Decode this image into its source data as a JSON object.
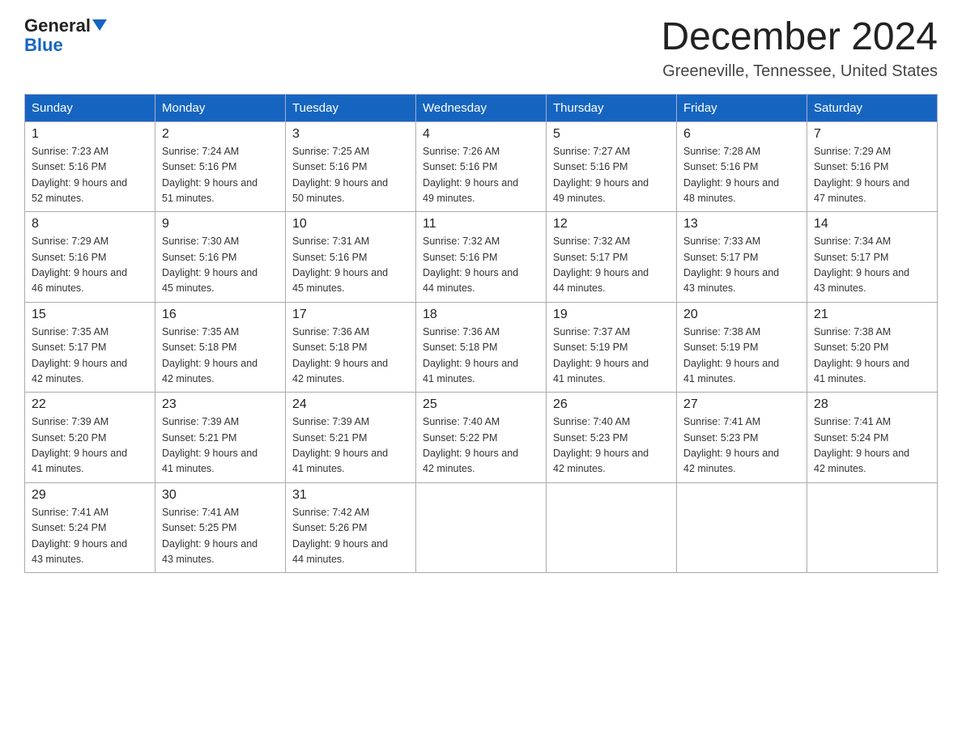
{
  "header": {
    "logo_line1": "General",
    "logo_line2": "Blue",
    "main_title": "December 2024",
    "subtitle": "Greeneville, Tennessee, United States"
  },
  "days_of_week": [
    "Sunday",
    "Monday",
    "Tuesday",
    "Wednesday",
    "Thursday",
    "Friday",
    "Saturday"
  ],
  "weeks": [
    [
      {
        "day": "1",
        "sunrise": "7:23 AM",
        "sunset": "5:16 PM",
        "daylight": "9 hours and 52 minutes."
      },
      {
        "day": "2",
        "sunrise": "7:24 AM",
        "sunset": "5:16 PM",
        "daylight": "9 hours and 51 minutes."
      },
      {
        "day": "3",
        "sunrise": "7:25 AM",
        "sunset": "5:16 PM",
        "daylight": "9 hours and 50 minutes."
      },
      {
        "day": "4",
        "sunrise": "7:26 AM",
        "sunset": "5:16 PM",
        "daylight": "9 hours and 49 minutes."
      },
      {
        "day": "5",
        "sunrise": "7:27 AM",
        "sunset": "5:16 PM",
        "daylight": "9 hours and 49 minutes."
      },
      {
        "day": "6",
        "sunrise": "7:28 AM",
        "sunset": "5:16 PM",
        "daylight": "9 hours and 48 minutes."
      },
      {
        "day": "7",
        "sunrise": "7:29 AM",
        "sunset": "5:16 PM",
        "daylight": "9 hours and 47 minutes."
      }
    ],
    [
      {
        "day": "8",
        "sunrise": "7:29 AM",
        "sunset": "5:16 PM",
        "daylight": "9 hours and 46 minutes."
      },
      {
        "day": "9",
        "sunrise": "7:30 AM",
        "sunset": "5:16 PM",
        "daylight": "9 hours and 45 minutes."
      },
      {
        "day": "10",
        "sunrise": "7:31 AM",
        "sunset": "5:16 PM",
        "daylight": "9 hours and 45 minutes."
      },
      {
        "day": "11",
        "sunrise": "7:32 AM",
        "sunset": "5:16 PM",
        "daylight": "9 hours and 44 minutes."
      },
      {
        "day": "12",
        "sunrise": "7:32 AM",
        "sunset": "5:17 PM",
        "daylight": "9 hours and 44 minutes."
      },
      {
        "day": "13",
        "sunrise": "7:33 AM",
        "sunset": "5:17 PM",
        "daylight": "9 hours and 43 minutes."
      },
      {
        "day": "14",
        "sunrise": "7:34 AM",
        "sunset": "5:17 PM",
        "daylight": "9 hours and 43 minutes."
      }
    ],
    [
      {
        "day": "15",
        "sunrise": "7:35 AM",
        "sunset": "5:17 PM",
        "daylight": "9 hours and 42 minutes."
      },
      {
        "day": "16",
        "sunrise": "7:35 AM",
        "sunset": "5:18 PM",
        "daylight": "9 hours and 42 minutes."
      },
      {
        "day": "17",
        "sunrise": "7:36 AM",
        "sunset": "5:18 PM",
        "daylight": "9 hours and 42 minutes."
      },
      {
        "day": "18",
        "sunrise": "7:36 AM",
        "sunset": "5:18 PM",
        "daylight": "9 hours and 41 minutes."
      },
      {
        "day": "19",
        "sunrise": "7:37 AM",
        "sunset": "5:19 PM",
        "daylight": "9 hours and 41 minutes."
      },
      {
        "day": "20",
        "sunrise": "7:38 AM",
        "sunset": "5:19 PM",
        "daylight": "9 hours and 41 minutes."
      },
      {
        "day": "21",
        "sunrise": "7:38 AM",
        "sunset": "5:20 PM",
        "daylight": "9 hours and 41 minutes."
      }
    ],
    [
      {
        "day": "22",
        "sunrise": "7:39 AM",
        "sunset": "5:20 PM",
        "daylight": "9 hours and 41 minutes."
      },
      {
        "day": "23",
        "sunrise": "7:39 AM",
        "sunset": "5:21 PM",
        "daylight": "9 hours and 41 minutes."
      },
      {
        "day": "24",
        "sunrise": "7:39 AM",
        "sunset": "5:21 PM",
        "daylight": "9 hours and 41 minutes."
      },
      {
        "day": "25",
        "sunrise": "7:40 AM",
        "sunset": "5:22 PM",
        "daylight": "9 hours and 42 minutes."
      },
      {
        "day": "26",
        "sunrise": "7:40 AM",
        "sunset": "5:23 PM",
        "daylight": "9 hours and 42 minutes."
      },
      {
        "day": "27",
        "sunrise": "7:41 AM",
        "sunset": "5:23 PM",
        "daylight": "9 hours and 42 minutes."
      },
      {
        "day": "28",
        "sunrise": "7:41 AM",
        "sunset": "5:24 PM",
        "daylight": "9 hours and 42 minutes."
      }
    ],
    [
      {
        "day": "29",
        "sunrise": "7:41 AM",
        "sunset": "5:24 PM",
        "daylight": "9 hours and 43 minutes."
      },
      {
        "day": "30",
        "sunrise": "7:41 AM",
        "sunset": "5:25 PM",
        "daylight": "9 hours and 43 minutes."
      },
      {
        "day": "31",
        "sunrise": "7:42 AM",
        "sunset": "5:26 PM",
        "daylight": "9 hours and 44 minutes."
      },
      null,
      null,
      null,
      null
    ]
  ]
}
